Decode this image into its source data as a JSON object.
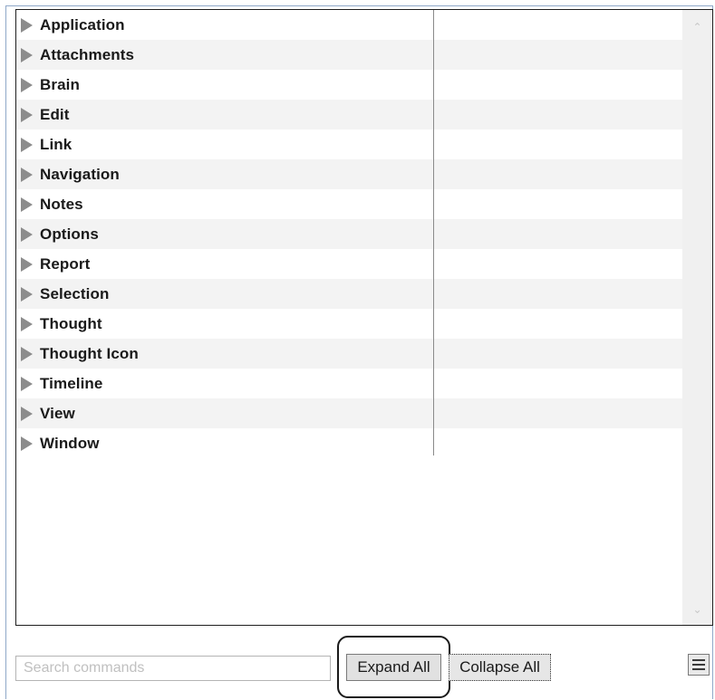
{
  "tree": {
    "items": [
      {
        "label": "Application"
      },
      {
        "label": "Attachments"
      },
      {
        "label": "Brain"
      },
      {
        "label": "Edit"
      },
      {
        "label": "Link"
      },
      {
        "label": "Navigation"
      },
      {
        "label": "Notes"
      },
      {
        "label": "Options"
      },
      {
        "label": "Report"
      },
      {
        "label": "Selection"
      },
      {
        "label": "Thought"
      },
      {
        "label": "Thought Icon"
      },
      {
        "label": "Timeline"
      },
      {
        "label": "View"
      },
      {
        "label": "Window"
      }
    ],
    "expand_icon": "triangle-right-icon"
  },
  "scrollbar": {
    "up_icon": "chevron-up-icon",
    "down_icon": "chevron-down-icon"
  },
  "footer": {
    "search_placeholder": "Search commands",
    "search_value": "",
    "expand_label": "Expand All",
    "collapse_label": "Collapse All",
    "menu_icon": "hamburger-menu-icon"
  },
  "colors": {
    "row_alt": "#f3f3f3",
    "triangle": "#8c8c8c",
    "frame_border": "#8fa8c8"
  }
}
